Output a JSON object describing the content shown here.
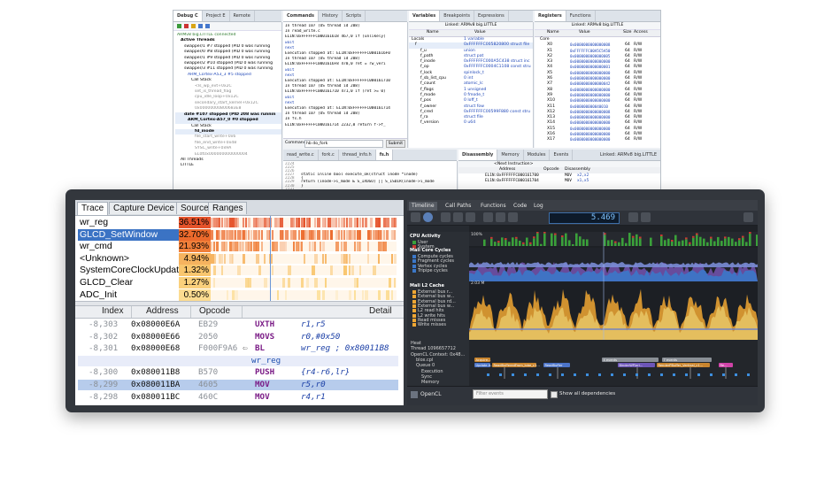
{
  "debugger": {
    "debug_tabs": [
      "Debug C",
      "Project E",
      "Remote"
    ],
    "commands_tabs": [
      "Commands",
      "History",
      "Scripts"
    ],
    "variables_tabs": [
      "Variables",
      "Breakpoints",
      "Expressions"
    ],
    "registers_tabs": [
      "Registers",
      "Functions"
    ],
    "debug_tree": [
      "ARMv8 big.LITTLE connected",
      "Active Threads",
      "swapper/1 #7 stopped (PID 0 was running",
      "swapper/0 #8 stopped (PID 0 was running",
      "swapper/1 #9 stopped (PID 0 was running",
      "swapper/2 #10 stopped (PID 0 was running",
      "swapper/3 #11 stopped (PID 0 was running",
      "ARM_Cortex-A53_3 #5 stopped",
      "Call Stack",
      "<ls_wp_evt+0x2C",
      "set_is_thread_flag",
      "cpu_idle_loop+0x12C",
      "secondary_start_kernel+0x12C",
      "0x00000000800683E8",
      "date #107 stopped (PID 208 was runnin",
      "ARM_Cortex-A57_0 #0 stopped",
      "Call Stack",
      "fd_inode",
      "file_start_write+0x6",
      "file_end_write+0x48",
      "SYSC_write+0x9A",
      "EL0t0x000000000000004",
      "All Threads",
      "LITTLE"
    ],
    "commands_lines": [
      "In thread 107 (OS thread id 208)",
      "In read_write.c",
      "EL1N:0xFFFFFFC000161618   467,0   if (unlikely(",
      "wait",
      "next",
      "Execution stopped at: EL1N:0xFFFFFFC0001616F0",
      "In thread 107 (OS thread id 208)",
      "EL1N:0xFFFFFFC0001616F8   470,0   ret = rw_veri",
      "wait",
      "next",
      "Execution stopped at: EL1N:0xFFFFFFC000161710",
      "In thread 107 (OS thread id 208)",
      "EL1N:0xFFFFFFC000161710   471,0   if (ret >= 0)",
      "wait",
      "next",
      "Execution stopped at: EL1N:0xFFFFFFC000161714",
      "In thread 107 (OS thread id 208)",
      "In fs.h",
      "EL1N:0xFFFFFFC000161714   2232,0   return f->f_"
    ],
    "command_label": "Command:",
    "command_value": "hb do_fork",
    "submit_label": "Submit",
    "variables_context": "Linked: ARMv8 big.LITTLE",
    "variables_cols": [
      "Name",
      "Value"
    ],
    "variables_rows": [
      {
        "name": "Locals",
        "value": "1 variable"
      },
      {
        "name": "f",
        "value": "0xFFFFFFC005820800  struct file"
      },
      {
        "name": "f_u",
        "value": "union"
      },
      {
        "name": "f_path",
        "value": "struct pat"
      },
      {
        "name": "f_inode",
        "value": "0xFFFFFFC000A5C438  struct inc"
      },
      {
        "name": "f_op",
        "value": "0xFFFFFFC0004C1108  const stru"
      },
      {
        "name": "f_lock",
        "value": "spinlock_t"
      },
      {
        "name": "f_sb_list_cpu",
        "value": "0  int"
      },
      {
        "name": "f_count",
        "value": "atomic_lc"
      },
      {
        "name": "f_flags",
        "value": "1  unsigned"
      },
      {
        "name": "f_mode",
        "value": "0  fmode_t"
      },
      {
        "name": "f_pos",
        "value": "0  loff_t"
      },
      {
        "name": "f_owner",
        "value": "struct fow"
      },
      {
        "name": "f_cred",
        "value": "0xFFFFFFC00599F880  const stru"
      },
      {
        "name": "f_ra",
        "value": "struct file"
      },
      {
        "name": "f_version",
        "value": "0  u64"
      }
    ],
    "registers_context": "Linked: ARMv8 big.LITTLE",
    "registers_cols": [
      "Name",
      "Value",
      "Size",
      "Access"
    ],
    "registers_rows": [
      {
        "name": "Core",
        "value": "",
        "size": "",
        "access": ""
      },
      {
        "name": "X0",
        "value": "0x0000000000000008",
        "size": "64",
        "access": "R/W"
      },
      {
        "name": "X1",
        "value": "0xFFFFFFC00A5C5A50",
        "size": "64",
        "access": "R/W"
      },
      {
        "name": "X2",
        "value": "0x0000000000000005",
        "size": "64",
        "access": "R/W"
      },
      {
        "name": "X3",
        "value": "0x0000000000000000",
        "size": "64",
        "access": "R/W"
      },
      {
        "name": "X4",
        "value": "0x0000000000000001",
        "size": "64",
        "access": "R/W"
      },
      {
        "name": "X5",
        "value": "0x0000000000000000",
        "size": "64",
        "access": "R/W"
      },
      {
        "name": "X6",
        "value": "0x0000000000000000",
        "size": "64",
        "access": "R/W"
      },
      {
        "name": "X7",
        "value": "0x0000000000000042",
        "size": "64",
        "access": "R/W"
      },
      {
        "name": "X8",
        "value": "0x0000000000000000",
        "size": "64",
        "access": "R/W"
      },
      {
        "name": "X9",
        "value": "0x0000000000000000",
        "size": "64",
        "access": "R/W"
      },
      {
        "name": "X10",
        "value": "0x0000000000000000",
        "size": "64",
        "access": "R/W"
      },
      {
        "name": "X11",
        "value": "0x000000000040010",
        "size": "64",
        "access": "R/W"
      },
      {
        "name": "X12",
        "value": "0x0000000000000008",
        "size": "64",
        "access": "R/W"
      },
      {
        "name": "X13",
        "value": "0x0000000000000000",
        "size": "64",
        "access": "R/W"
      },
      {
        "name": "X14",
        "value": "0x0000000000000000",
        "size": "64",
        "access": "R/W"
      },
      {
        "name": "X15",
        "value": "0x0000000000000000",
        "size": "64",
        "access": "R/W"
      },
      {
        "name": "X16",
        "value": "0x0000000000000000",
        "size": "64",
        "access": "R/W"
      },
      {
        "name": "X17",
        "value": "0x0000000000000000",
        "size": "64",
        "access": "R/W"
      }
    ],
    "source_tabs": [
      "read_write.c",
      "fork.c",
      "thread_info.h",
      "fs.h"
    ],
    "source_lines": [
      {
        "num": "2224",
        "text": ""
      },
      {
        "num": "2225",
        "text": ""
      },
      {
        "num": "2226",
        "text": ""
      },
      {
        "num": "2227",
        "text": "static inline bool execute_ok(struct inode *inode)"
      },
      {
        "num": "2228",
        "text": "{"
      },
      {
        "num": "2229",
        "text": "    return (inode->i_mode & S_IXUGO) || S_ISDIR(inode->i_mode"
      },
      {
        "num": "2230",
        "text": "}"
      },
      {
        "num": "2231",
        "text": ""
      },
      {
        "num": "2232",
        "text": "static inline struct inode *file_inode(struct file *f)"
      }
    ],
    "disasm_tabs": [
      "Disassembly",
      "Memory",
      "Modules",
      "Events"
    ],
    "disasm_context": "Linked: ARMv8 big.LITTLE",
    "disasm_next": "<Next Instruction>",
    "disasm_cols": [
      "Address",
      "Opcode",
      "Disassembly"
    ],
    "disasm_rows": [
      {
        "addr": "EL1N:0xFFFFFFC000161700",
        "op": "MOV",
        "dis": "x2,x2"
      },
      {
        "addr": "EL1N:0xFFFFFFC000161704",
        "op": "MOV",
        "dis": "x1,x5"
      }
    ]
  },
  "trace": {
    "tabs": [
      "Trace",
      "Capture Device",
      "Source",
      "Ranges"
    ],
    "active_tab": 0,
    "functions": [
      {
        "name": "wr_reg",
        "pct": "36.51%",
        "pct_value": 36.51,
        "color": "#e5532b",
        "selected": false
      },
      {
        "name": "GLCD_SetWindow",
        "pct": "32.70%",
        "pct_value": 32.7,
        "color": "#ec6a2c",
        "selected": true
      },
      {
        "name": "wr_cmd",
        "pct": "21.93%",
        "pct_value": 21.93,
        "color": "#f07f3a",
        "selected": false
      },
      {
        "name": "<Unknown>",
        "pct": "4.94%",
        "pct_value": 4.94,
        "color": "#f6b35f",
        "selected": false
      },
      {
        "name": "SystemCoreClockUpdate",
        "pct": "1.32%",
        "pct_value": 1.32,
        "color": "#f9c66e",
        "selected": false
      },
      {
        "name": "GLCD_Clear",
        "pct": "1.27%",
        "pct_value": 1.27,
        "color": "#fad07c",
        "selected": false
      },
      {
        "name": "ADC_Init",
        "pct": "0.50%",
        "pct_value": 0.5,
        "color": "#fcdc91",
        "selected": false
      }
    ],
    "columns": [
      "Index",
      "Address",
      "Opcode",
      "Detail"
    ],
    "rows": [
      {
        "index": "-8,303",
        "address": "0x08000E6A",
        "opcode": "EB29",
        "mnemonic": "UXTH",
        "operands": "r1,r5",
        "comment": "",
        "kind": "instr"
      },
      {
        "index": "-8,302",
        "address": "0x08000E66",
        "opcode": "2050",
        "mnemonic": "MOVS",
        "operands": "r0,#0x50",
        "comment": "",
        "kind": "instr"
      },
      {
        "index": "-8,301",
        "address": "0x08000E68",
        "opcode": "F000F9A6",
        "mnemonic": "BL",
        "operands": "wr_reg ; 0x80011B8",
        "comment": "",
        "kind": "instr"
      },
      {
        "index": "",
        "address": "",
        "opcode": "",
        "mnemonic": "wr_reg",
        "operands": "",
        "comment": "",
        "kind": "label"
      },
      {
        "index": "-8,300",
        "address": "0x080011B8",
        "opcode": "B570",
        "mnemonic": "PUSH",
        "operands": "{r4-r6,lr}",
        "comment": "",
        "kind": "instr"
      },
      {
        "index": "-8,299",
        "address": "0x080011BA",
        "opcode": "4605",
        "mnemonic": "MOV",
        "operands": "r5,r0",
        "comment": "",
        "kind": "selected"
      },
      {
        "index": "-8,298",
        "address": "0x080011BC",
        "opcode": "460C",
        "mnemonic": "MOV",
        "operands": "r4,r1",
        "comment": "",
        "kind": "instr"
      }
    ]
  },
  "timeline": {
    "tabs": [
      "Timeline",
      "Call Paths",
      "Functions",
      "Code",
      "Log"
    ],
    "time_readout": "5.469",
    "tracks": [
      {
        "label": "CPU Activity",
        "head": true,
        "subs": [
          "User",
          "System"
        ]
      },
      {
        "label": "Mali Core Cycles",
        "head": true,
        "subs": [
          "Compute cycles",
          "Fragment cycles",
          "Vertex cycles",
          "Tripipe cycles"
        ]
      },
      {
        "label": "Mali L2 Cache",
        "head": true,
        "subs": [
          "External bus r...",
          "External bus w...",
          "External bus rd...",
          "External bus w...",
          "L2 read hits",
          "L2 write hits",
          "Read misses",
          "Write misses"
        ]
      }
    ],
    "ymax_cpu": "100%",
    "ymax_l2": "2.03 M",
    "heat_labels": [
      "Heat",
      "Thread 1096657712",
      "OpenCL Context: 0x48...",
      "blox.cpl",
      "Queue 0",
      "Execution",
      "Sync",
      "Memory"
    ],
    "opencl_label": "OpenCL",
    "filter_placeholder": "Filter events",
    "show_deps_label": "Show all dependencies",
    "boxes": [
      "Acquire...",
      "Update A...",
      "ReadBufferedFrom_lobe_c1...",
      "ReadBuffer",
      "4 events",
      "7 events",
      "BinderWP/ori...",
      "RenderPBuffer_Vertical_c1...",
      "Re..."
    ],
    "colors": {
      "cpu_user": "#3aa13a",
      "cpu_sys": "#c73b33",
      "mali_blue": "#3b78c9",
      "mali_violet": "#6f51a8",
      "l2_orange": "#f0a733",
      "l2_yellow": "#e7c566"
    }
  }
}
